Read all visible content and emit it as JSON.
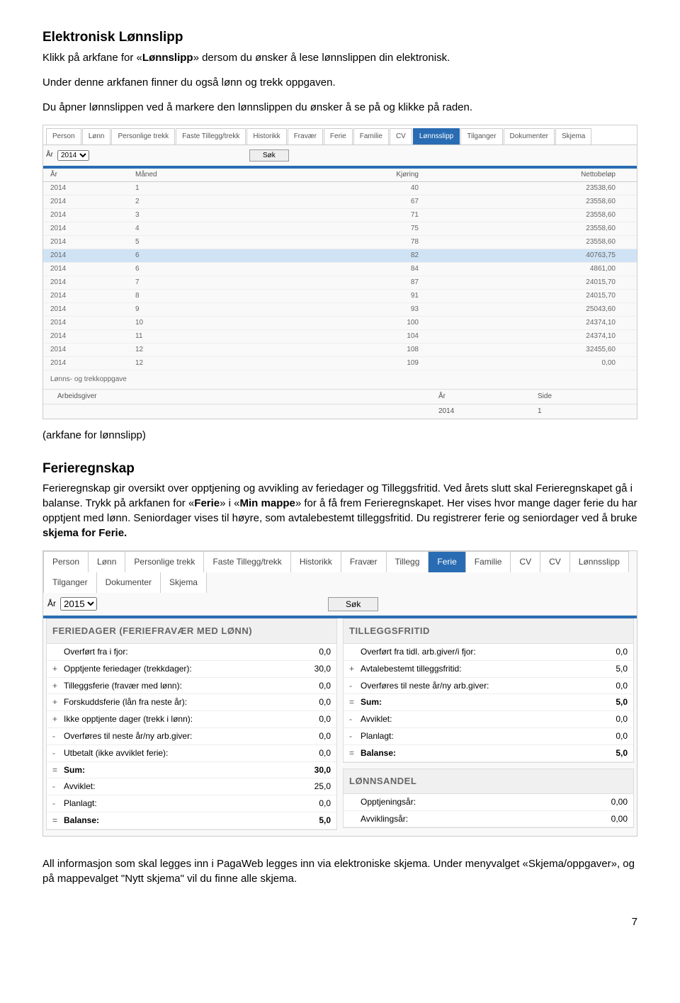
{
  "section1": {
    "title": "Elektronisk Lønnslipp",
    "p1a": "Klikk på arkfane for «",
    "p1b": "Lønnslipp",
    "p1c": "» dersom du ønsker å lese lønnslippen din elektronisk.",
    "p2": "Under denne arkfanen finner du også lønn og trekk oppgaven.",
    "p3": "Du åpner lønnslippen ved å markere den lønnslippen du ønsker å se på og klikke på raden.",
    "caption": "(arkfane for lønnslipp)"
  },
  "shot1": {
    "tabs": [
      "Person",
      "Lønn",
      "Personlige trekk",
      "Faste Tillegg/trekk",
      "Historikk",
      "Fravær",
      "Ferie",
      "Familie",
      "CV",
      "Lønnsslipp",
      "Tilganger",
      "Dokumenter",
      "Skjema"
    ],
    "activeIndex": 9,
    "arLabel": "År",
    "arValue": "2014",
    "sokLabel": "Søk",
    "cols": [
      "År",
      "Måned",
      "Kjøring",
      "Nettobeløp"
    ],
    "rows": [
      [
        "2014",
        "1",
        "40",
        "23538,60"
      ],
      [
        "2014",
        "2",
        "67",
        "23558,60"
      ],
      [
        "2014",
        "3",
        "71",
        "23558,60"
      ],
      [
        "2014",
        "4",
        "75",
        "23558,60"
      ],
      [
        "2014",
        "5",
        "78",
        "23558,60"
      ],
      [
        "2014",
        "6",
        "82",
        "40763,75"
      ],
      [
        "2014",
        "6",
        "84",
        "4861,00"
      ],
      [
        "2014",
        "7",
        "87",
        "24015,70"
      ],
      [
        "2014",
        "8",
        "91",
        "24015,70"
      ],
      [
        "2014",
        "9",
        "93",
        "25043,60"
      ],
      [
        "2014",
        "10",
        "100",
        "24374,10"
      ],
      [
        "2014",
        "11",
        "104",
        "24374,10"
      ],
      [
        "2014",
        "12",
        "108",
        "32455,60"
      ],
      [
        "2014",
        "12",
        "109",
        "0,00"
      ]
    ],
    "sub": {
      "title": "Lønns- og trekkoppgave",
      "cols": [
        "Arbeidsgiver",
        "År",
        "Side"
      ],
      "row": [
        "",
        "2014",
        "1"
      ]
    }
  },
  "section2": {
    "title": "Ferieregnskap",
    "p1": "Ferieregnskap gir oversikt over opptjening og avvikling av feriedager og Tilleggsfritid. Ved årets slutt skal Ferieregnskapet gå i balanse. Trykk på arkfanen for «",
    "b1": "Ferie",
    "p2": "» i «",
    "b2": "Min mappe",
    "p3": "» for å få frem Ferieregnskapet.  Her vises hvor mange dager ferie du har opptjent med lønn. Seniordager vises til høyre,  som avtalebestemt tilleggsfritid. Du registrerer ferie og seniordager ved å bruke ",
    "b3": "skjema  for Ferie."
  },
  "shot2": {
    "tabsTop": [
      "Person",
      "Lønn",
      "Personlige trekk",
      "Faste Tillegg/trekk",
      "Historikk",
      "Fravær",
      "Tillegg",
      "Ferie",
      "Familie",
      "CV",
      "CV",
      "Lønnsslipp"
    ],
    "tabsBottom": [
      "Tilganger",
      "Dokumenter",
      "Skjema"
    ],
    "activeIndex": 7,
    "arLabel": "År",
    "arValue": "2015",
    "sokLabel": "Søk",
    "left": {
      "title": "FERIEDAGER (FERIEFRAVÆR MED LØNN)",
      "rows": [
        [
          "",
          "Overført fra i fjor:",
          "0,0"
        ],
        [
          "+",
          "Opptjente feriedager (trekkdager):",
          "30,0"
        ],
        [
          "+",
          "Tilleggsferie (fravær med lønn):",
          "0,0"
        ],
        [
          "+",
          "Forskuddsferie (lån fra neste år):",
          "0,0"
        ],
        [
          "+",
          "Ikke opptjente dager (trekk i lønn):",
          "0,0"
        ],
        [
          "-",
          "Overføres til neste år/ny arb.giver:",
          "0,0"
        ],
        [
          "-",
          "Utbetalt (ikke avviklet ferie):",
          "0,0"
        ],
        [
          "=",
          "Sum:",
          "30,0"
        ],
        [
          "-",
          "Avviklet:",
          "25,0"
        ],
        [
          "-",
          "Planlagt:",
          "0,0"
        ],
        [
          "=",
          "Balanse:",
          "5,0"
        ]
      ]
    },
    "rightTop": {
      "title": "TILLEGGSFRITID",
      "rows": [
        [
          "",
          "Overført fra tidl. arb.giver/i fjor:",
          "0,0"
        ],
        [
          "+",
          "Avtalebestemt tilleggsfritid:",
          "5,0"
        ],
        [
          "-",
          "Overføres til neste år/ny arb.giver:",
          "0,0"
        ],
        [
          "=",
          "Sum:",
          "5,0"
        ],
        [
          "-",
          "Avviklet:",
          "0,0"
        ],
        [
          "-",
          "Planlagt:",
          "0,0"
        ],
        [
          "=",
          "Balanse:",
          "5,0"
        ]
      ]
    },
    "rightBottom": {
      "title": "LØNNSANDEL",
      "rows": [
        [
          "",
          "Opptjeningsår:",
          "0,00"
        ],
        [
          "",
          "Avviklingsår:",
          "0,00"
        ]
      ]
    }
  },
  "closing": {
    "p1": "All informasjon som skal legges inn i PagaWeb legges inn via elektroniske skjema. Under menyvalget «Skjema/oppgaver», og på mappevalget \"Nytt skjema\" vil du finne alle skjema."
  },
  "pagenum": "7"
}
